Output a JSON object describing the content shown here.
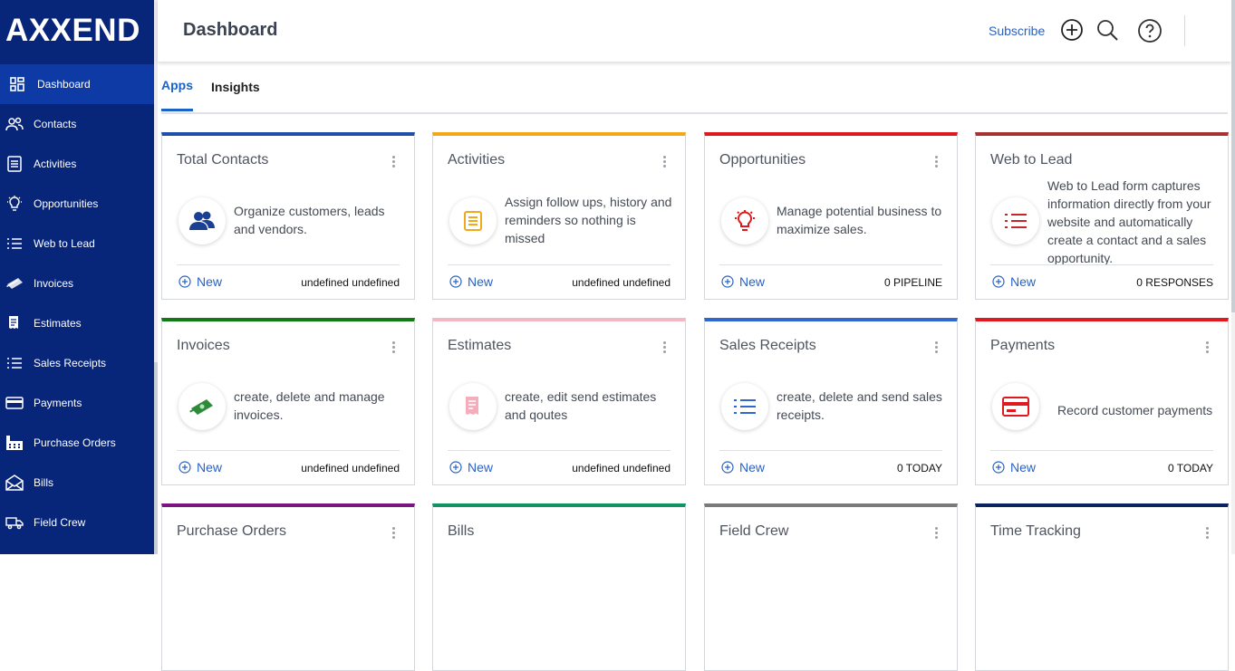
{
  "brand": "AXXEND",
  "nav": [
    {
      "label": "Dashboard",
      "icon": "dashboard-icon",
      "active": true
    },
    {
      "label": "Contacts",
      "icon": "contacts-icon"
    },
    {
      "label": "Activities",
      "icon": "activities-icon"
    },
    {
      "label": "Opportunities",
      "icon": "lightbulb-icon"
    },
    {
      "label": "Web to Lead",
      "icon": "list-icon"
    },
    {
      "label": "Invoices",
      "icon": "money-icon"
    },
    {
      "label": "Estimates",
      "icon": "receipt-icon"
    },
    {
      "label": "Sales Receipts",
      "icon": "list-icon"
    },
    {
      "label": "Payments",
      "icon": "card-icon"
    },
    {
      "label": "Purchase Orders",
      "icon": "factory-icon"
    },
    {
      "label": "Bills",
      "icon": "envelope-icon"
    },
    {
      "label": "Field Crew",
      "icon": "truck-icon"
    }
  ],
  "header": {
    "title": "Dashboard",
    "subscribe": "Subscribe"
  },
  "tabs": [
    {
      "label": "Apps",
      "active": true
    },
    {
      "label": "Insights"
    }
  ],
  "new_label": "New",
  "cards": [
    {
      "title": "Total Contacts",
      "desc": "Organize customers, leads and vendors.",
      "stat": "undefined undefined",
      "accent": "#1f4fa8",
      "icon": "contacts-icon"
    },
    {
      "title": "Activities",
      "desc": "Assign follow ups, history and reminders so nothing is missed",
      "stat": "undefined undefined",
      "accent": "#f2a81d",
      "icon": "notepad-icon"
    },
    {
      "title": "Opportunities",
      "desc": "Manage potential business to maximize sales.",
      "stat": "0 PIPELINE",
      "accent": "#e0191e",
      "icon": "lightbulb-icon"
    },
    {
      "title": "Web to Lead",
      "desc": "Web to Lead form captures information directly from your website and automatically create a contact and a sales opportunity.",
      "stat": "0 RESPONSES",
      "accent": "#a83232",
      "icon": "list-icon"
    },
    {
      "title": "Invoices",
      "desc": "create, delete and manage invoices.",
      "stat": "undefined undefined",
      "accent": "#127a14",
      "icon": "money-icon"
    },
    {
      "title": "Estimates",
      "desc": "create, edit send estimates and qoutes",
      "stat": "undefined undefined",
      "accent": "#f4b8c4",
      "icon": "receipt-icon"
    },
    {
      "title": "Sales Receipts",
      "desc": "create, delete and send sales receipts.",
      "stat": "0 TODAY",
      "accent": "#2f67cf",
      "icon": "list-icon"
    },
    {
      "title": "Payments",
      "desc": "Record customer payments",
      "stat": "0 TODAY",
      "accent": "#e0191e",
      "icon": "card-icon"
    },
    {
      "title": "Purchase Orders",
      "accent": "#7b1680"
    },
    {
      "title": "Bills",
      "accent": "#109464"
    },
    {
      "title": "Field Crew",
      "accent": "#7a7a7a"
    },
    {
      "title": "Time Tracking",
      "accent": "#0b2460"
    }
  ]
}
